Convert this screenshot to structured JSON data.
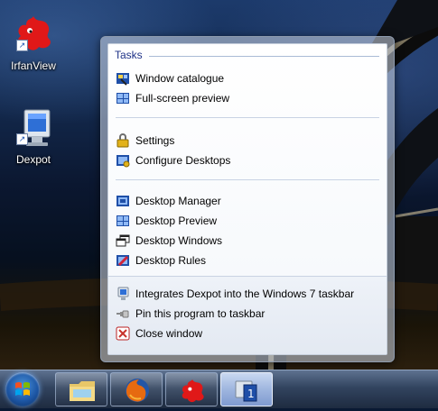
{
  "desktop": {
    "icons": [
      {
        "label": "IrfanView",
        "icon": "irfanview-icon"
      },
      {
        "label": "Dexpot",
        "icon": "dexpot-monitor-icon"
      }
    ]
  },
  "jumplist": {
    "tasks_header": "Tasks",
    "tasks": [
      {
        "label": "Window catalogue",
        "icon": "window-catalogue-icon"
      },
      {
        "label": "Full-screen preview",
        "icon": "full-screen-preview-icon"
      }
    ],
    "group2": [
      {
        "label": "Settings",
        "icon": "settings-lock-icon"
      },
      {
        "label": "Configure Desktops",
        "icon": "configure-desktops-icon"
      }
    ],
    "group3": [
      {
        "label": "Desktop Manager",
        "icon": "desktop-manager-icon"
      },
      {
        "label": "Desktop Preview",
        "icon": "desktop-preview-icon"
      },
      {
        "label": "Desktop Windows",
        "icon": "desktop-windows-icon"
      },
      {
        "label": "Desktop Rules",
        "icon": "desktop-rules-icon"
      }
    ],
    "footer": [
      {
        "label": "Integrates Dexpot into the Windows 7 taskbar",
        "icon": "dexpot-app-icon"
      },
      {
        "label": "Pin this program to taskbar",
        "icon": "pin-icon"
      },
      {
        "label": "Close window",
        "icon": "close-window-icon"
      }
    ]
  },
  "taskbar": {
    "buttons": [
      {
        "name": "start-button",
        "icon": "windows-logo-icon"
      },
      {
        "name": "explorer",
        "icon": "folder-icon"
      },
      {
        "name": "firefox",
        "icon": "firefox-icon"
      },
      {
        "name": "irfanview",
        "icon": "irfanview-icon"
      },
      {
        "name": "dexpot",
        "icon": "dexpot-icon",
        "active": true
      }
    ]
  },
  "colors": {
    "tasks_header": "#1e3287",
    "taskbar": "#32445f",
    "close_red": "#c8322b"
  }
}
